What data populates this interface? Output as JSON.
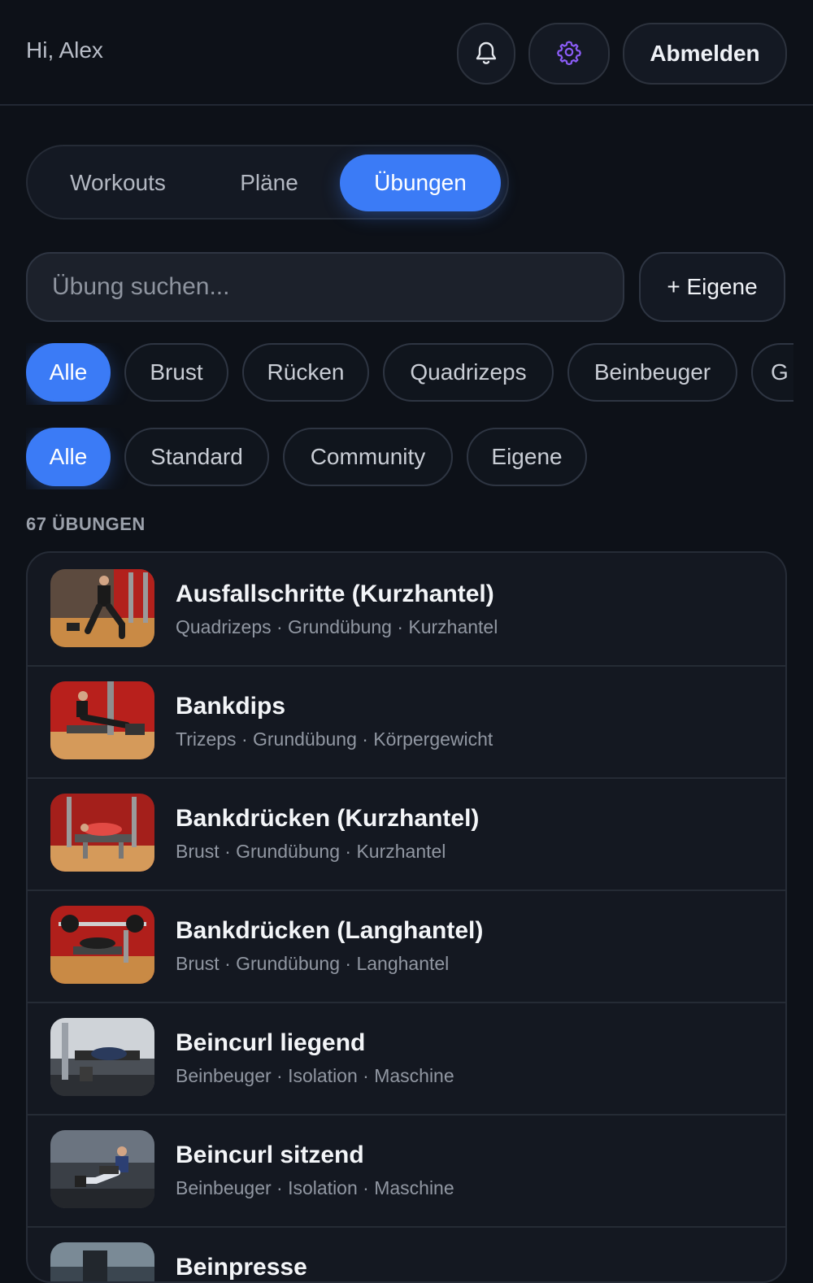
{
  "header": {
    "greeting": "Hi, Alex",
    "icons": [
      "bell-icon",
      "gear-icon"
    ],
    "logout_label": "Abmelden"
  },
  "tabs": [
    {
      "label": "Workouts",
      "active": false
    },
    {
      "label": "Pläne",
      "active": false
    },
    {
      "label": "Übungen",
      "active": true
    }
  ],
  "search": {
    "placeholder": "Übung suchen...",
    "add_label": "+ Eigene"
  },
  "muscle_filters": [
    "Alle",
    "Brust",
    "Rücken",
    "Quadrizeps",
    "Beinbeuger",
    "G"
  ],
  "source_filters": [
    "Alle",
    "Standard",
    "Community",
    "Eigene"
  ],
  "count_label": "67 ÜBUNGEN",
  "exercises": [
    {
      "name": "Ausfallschritte (Kurzhantel)",
      "meta": "Quadrizeps · Grundübung · Kurzhantel"
    },
    {
      "name": "Bankdips",
      "meta": "Trizeps · Grundübung · Körpergewicht"
    },
    {
      "name": "Bankdrücken (Kurzhantel)",
      "meta": "Brust · Grundübung · Kurzhantel"
    },
    {
      "name": "Bankdrücken (Langhantel)",
      "meta": "Brust · Grundübung · Langhantel"
    },
    {
      "name": "Beincurl liegend",
      "meta": "Beinbeuger · Isolation · Maschine"
    },
    {
      "name": "Beincurl sitzend",
      "meta": "Beinbeuger · Isolation · Maschine"
    },
    {
      "name": "Beinpresse",
      "meta": ""
    }
  ],
  "colors": {
    "accent": "#3b7bf6",
    "background": "#0d1118",
    "gear_icon": "#8b5cf6"
  }
}
